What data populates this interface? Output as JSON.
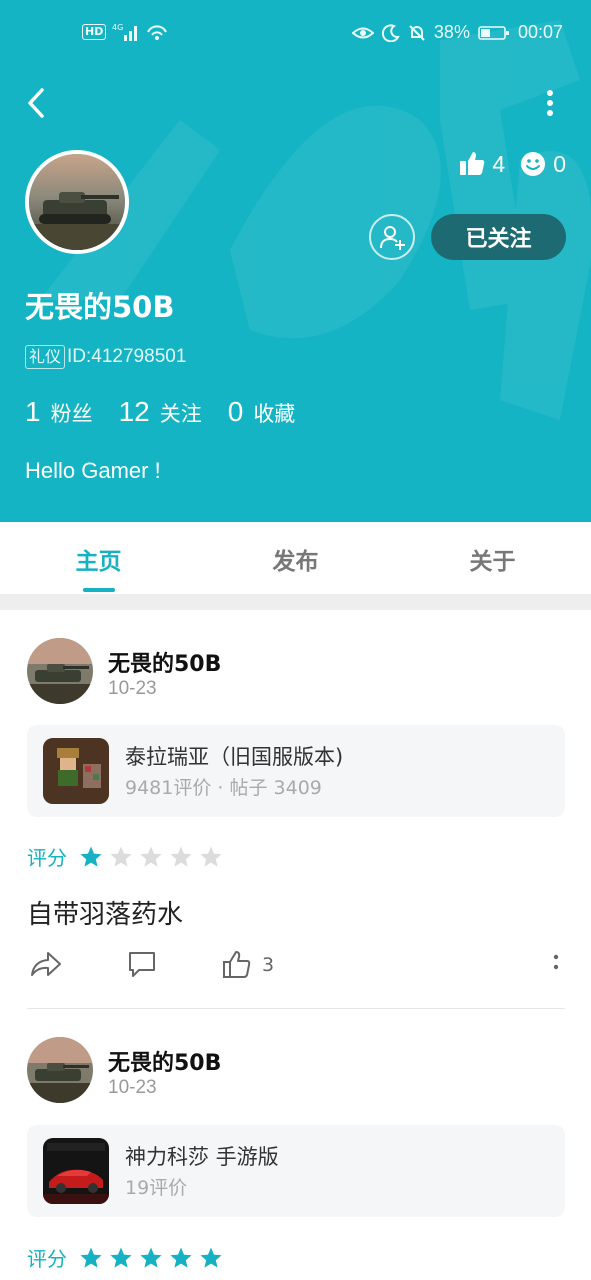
{
  "status_bar": {
    "network": "HD",
    "signal_label": "4G",
    "battery": "38%",
    "time": "00:07"
  },
  "profile": {
    "name": "无畏的50B",
    "badge": "礼仪",
    "id": "ID:412798501",
    "likes": "4",
    "smiles": "0",
    "follow_state": "已关注",
    "fans_count": "1",
    "fans_label": "粉丝",
    "following_count": "12",
    "following_label": "关注",
    "favorites_count": "0",
    "favorites_label": "收藏",
    "bio": "Hello Gamer !"
  },
  "tabs": [
    {
      "label": "主页",
      "active": true
    },
    {
      "label": "发布",
      "active": false
    },
    {
      "label": "关于",
      "active": false
    }
  ],
  "posts": [
    {
      "author": "无畏的50B",
      "date": "10-23",
      "game_title": "泰拉瑞亚（旧国服版本)",
      "game_meta": "9481评价 · 帖子 3409",
      "rating_label": "评分",
      "rating": 1,
      "text": "自带羽落药水",
      "likes": "3"
    },
    {
      "author": "无畏的50B",
      "date": "10-23",
      "game_title": "神力科莎 手游版",
      "game_meta": "19评价",
      "rating_label": "评分",
      "rating": 5
    }
  ],
  "icons": {
    "back": "back-arrow-icon",
    "more": "more-vertical-icon",
    "like": "thumbs-up-icon",
    "smile": "smile-icon",
    "add_friend": "add-friend-icon",
    "share": "share-icon",
    "comment": "comment-icon"
  },
  "colors": {
    "header_bg": "#14b4c4",
    "accent": "#16b1c2",
    "follow_button": "#1e6a72",
    "star_active": "#16b1c2",
    "star_inactive": "#dcdcdc"
  }
}
